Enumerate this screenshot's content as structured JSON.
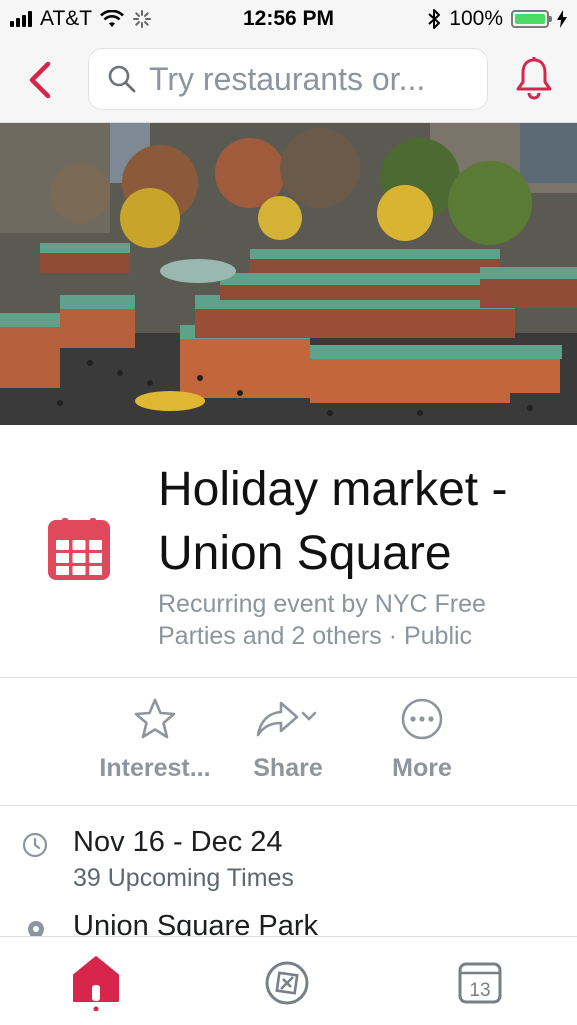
{
  "status_bar": {
    "carrier": "AT&T",
    "time": "12:56 PM",
    "battery_percent": "100%",
    "icons": [
      "signal-icon",
      "wifi-icon",
      "activity-spinner-icon",
      "bluetooth-icon",
      "battery-icon",
      "charging-bolt-icon"
    ]
  },
  "nav": {
    "search_placeholder": "Try restaurants or...",
    "icons": [
      "back-chevron-icon",
      "search-icon",
      "bell-icon"
    ],
    "accent_color": "#d7254b"
  },
  "event": {
    "title": "Holiday market - Union Square",
    "subtitle": "Recurring event by NYC Free Parties and 2 others · Public",
    "calendar_icon_color": "#e0485c"
  },
  "actions": [
    {
      "label": "Interest...",
      "icon": "star-icon"
    },
    {
      "label": "Share",
      "icon": "share-arrow-icon"
    },
    {
      "label": "More",
      "icon": "more-dots-icon"
    }
  ],
  "details": {
    "date_range": "Nov 16 - Dec 24",
    "upcoming": "39 Upcoming Times",
    "location": "Union Square Park"
  },
  "tab_bar": {
    "calendar_day": "13",
    "icons": [
      "home-icon",
      "explore-icon",
      "calendar-icon"
    ],
    "active_color": "#d7254b"
  }
}
